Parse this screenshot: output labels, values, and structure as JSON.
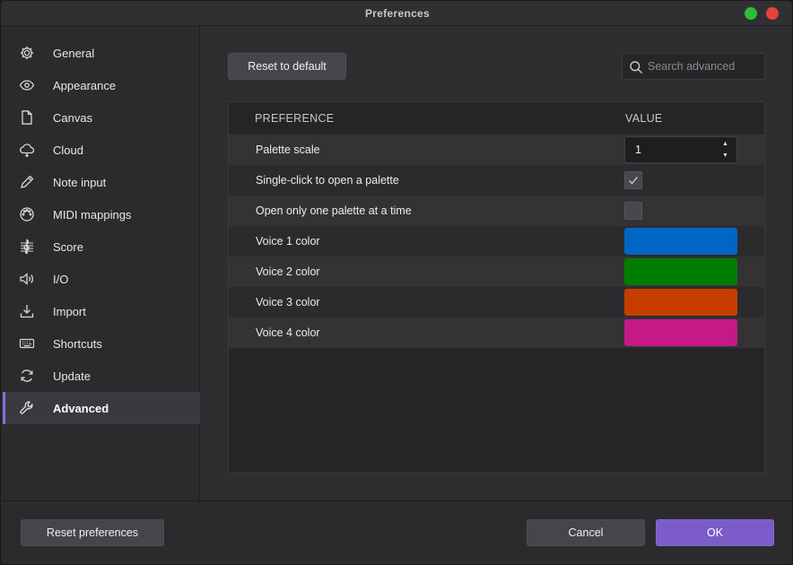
{
  "window": {
    "title": "Preferences"
  },
  "sidebar": {
    "items": [
      {
        "label": "General",
        "icon": "gear-icon"
      },
      {
        "label": "Appearance",
        "icon": "eye-icon"
      },
      {
        "label": "Canvas",
        "icon": "page-icon"
      },
      {
        "label": "Cloud",
        "icon": "cloud-icon"
      },
      {
        "label": "Note input",
        "icon": "pencil-icon"
      },
      {
        "label": "MIDI mappings",
        "icon": "midi-icon"
      },
      {
        "label": "Score",
        "icon": "treble-clef-icon"
      },
      {
        "label": "I/O",
        "icon": "speaker-icon"
      },
      {
        "label": "Import",
        "icon": "import-icon"
      },
      {
        "label": "Shortcuts",
        "icon": "keyboard-icon"
      },
      {
        "label": "Update",
        "icon": "refresh-icon"
      },
      {
        "label": "Advanced",
        "icon": "wrench-icon",
        "active": true
      }
    ]
  },
  "main": {
    "reset_default_label": "Reset to default",
    "search": {
      "placeholder": "Search advanced",
      "value": ""
    },
    "table": {
      "headers": {
        "preference": "PREFERENCE",
        "value": "VALUE"
      },
      "rows": [
        {
          "name": "Palette scale",
          "type": "spinbox",
          "value": "1"
        },
        {
          "name": "Single-click to open a palette",
          "type": "checkbox",
          "checked": true
        },
        {
          "name": "Open only one palette at a time",
          "type": "checkbox",
          "checked": false
        },
        {
          "name": "Voice 1 color",
          "type": "color",
          "color": "#0065c3"
        },
        {
          "name": "Voice 2 color",
          "type": "color",
          "color": "#007d00"
        },
        {
          "name": "Voice 3 color",
          "type": "color",
          "color": "#c53e00"
        },
        {
          "name": "Voice 4 color",
          "type": "color",
          "color": "#c51a85"
        }
      ]
    }
  },
  "footer": {
    "reset_prefs_label": "Reset preferences",
    "cancel_label": "Cancel",
    "ok_label": "OK"
  },
  "colors": {
    "accent": "#7b5cc9",
    "maximize": "#2dbb3a",
    "close": "#e2443d"
  }
}
